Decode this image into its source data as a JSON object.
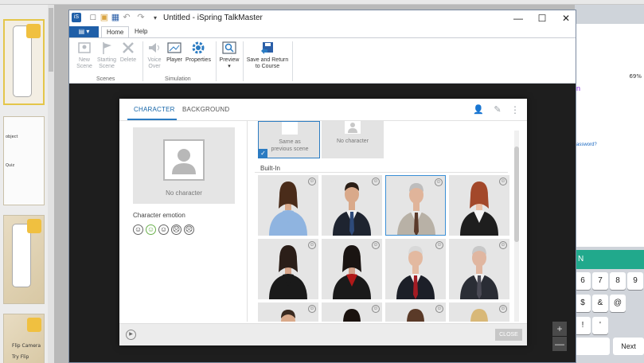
{
  "window": {
    "title": "Untitled - iSpring TalkMaster",
    "app_icon": "ispring-logo-icon",
    "quick_access": [
      "new-icon",
      "open-icon",
      "save-icon",
      "undo-icon",
      "redo-icon",
      "customize-icon"
    ],
    "controls": {
      "minimize": "—",
      "maximize": "☐",
      "close": "✕"
    }
  },
  "ribbon": {
    "file_tab_icon": "file-menu-icon",
    "tabs": [
      {
        "label": "Home",
        "active": true
      },
      {
        "label": "Help",
        "active": false
      }
    ],
    "groups": [
      {
        "label": "Scenes",
        "buttons": [
          {
            "label_line1": "New",
            "label_line2": "Scene",
            "icon": "new-scene-icon",
            "enabled": false
          },
          {
            "label_line1": "Starting",
            "label_line2": "Scene",
            "icon": "flag-icon",
            "enabled": false
          },
          {
            "label_line1": "Delete",
            "label_line2": "",
            "icon": "delete-icon",
            "enabled": false
          }
        ]
      },
      {
        "label": "Simulation",
        "buttons": [
          {
            "label_line1": "Voice",
            "label_line2": "Over",
            "icon": "speaker-icon",
            "enabled": false
          },
          {
            "label_line1": "Player",
            "label_line2": "",
            "icon": "player-icon",
            "enabled": true
          },
          {
            "label_line1": "Properties",
            "label_line2": "",
            "icon": "gear-icon",
            "enabled": true
          }
        ]
      },
      {
        "label": "",
        "buttons": [
          {
            "label_line1": "Preview",
            "label_line2": "▾",
            "icon": "preview-icon",
            "enabled": true
          }
        ]
      },
      {
        "label": "",
        "buttons": [
          {
            "label_line1": "Save and Return",
            "label_line2": "to Course",
            "icon": "save-return-icon",
            "enabled": true
          }
        ]
      }
    ]
  },
  "dialog": {
    "tabs": [
      {
        "label": "CHARACTER",
        "active": true
      },
      {
        "label": "BACKGROUND",
        "active": false
      }
    ],
    "tools": [
      "add-character-icon",
      "edit-icon",
      "more-icon"
    ],
    "preview": {
      "label": "No character"
    },
    "emotion_label": "Character emotion",
    "emotions": [
      {
        "glyph": "☺",
        "name": "neutral-emotion-icon",
        "selected": false
      },
      {
        "glyph": "☺",
        "name": "happy-emotion-icon",
        "selected": true
      },
      {
        "glyph": "☺",
        "name": "smile-emotion-icon",
        "selected": false
      },
      {
        "glyph": "☹",
        "name": "sad-emotion-icon",
        "selected": false
      },
      {
        "glyph": "☹",
        "name": "angry-emotion-icon",
        "selected": false
      }
    ],
    "special_cards": [
      {
        "label_line1": "Same as",
        "label_line2": "previous scene",
        "selected": true
      },
      {
        "label_line1": "No character",
        "label_line2": "",
        "selected": false
      }
    ],
    "builtin_label": "Built-In",
    "characters": [
      {
        "name": "character-woman-blue-shirt",
        "skin": "#d9a98a",
        "hair": "#4a2c1a",
        "outfit": "#8fb4e0",
        "shirt": "#8fb4e0",
        "tie": null,
        "gender": "f",
        "selected": false
      },
      {
        "name": "character-man-dark-suit",
        "skin": "#d9a98a",
        "hair": "#2a1e16",
        "outfit": "#1e2430",
        "shirt": "#f2f2f2",
        "tie": "#2e4a7a",
        "gender": "m",
        "selected": false
      },
      {
        "name": "character-older-man-gray-jacket",
        "skin": "#e0b49a",
        "hair": "#bdbdbd",
        "outfit": "#b8b1a6",
        "shirt": "#eaeaea",
        "tie": "#5a3a2a",
        "gender": "m",
        "selected": true
      },
      {
        "name": "character-redhead-woman",
        "skin": "#ecc0a6",
        "hair": "#a3482a",
        "outfit": "#1e1e1e",
        "shirt": "#f5f5f5",
        "tie": null,
        "gender": "f",
        "selected": false
      },
      {
        "name": "character-woman-black-blazer",
        "skin": "#d7a58a",
        "hair": "#2b1e18",
        "outfit": "#1a1a1a",
        "shirt": "#1a1a1a",
        "tie": null,
        "gender": "f",
        "selected": false
      },
      {
        "name": "character-woman-red-top",
        "skin": "#d3a088",
        "hair": "#1a1412",
        "outfit": "#1a1a1a",
        "shirt": "#b01818",
        "tie": null,
        "gender": "f",
        "selected": false
      },
      {
        "name": "character-older-man-red-tie",
        "skin": "#e3b9a0",
        "hair": "#d8d8d8",
        "outfit": "#1c1f28",
        "shirt": "#f2f2f2",
        "tie": "#a41c24",
        "gender": "m",
        "selected": false
      },
      {
        "name": "character-older-man-glasses",
        "skin": "#e0b6a0",
        "hair": "#c8c8c8",
        "outfit": "#2a2d35",
        "shirt": "#f2f2f2",
        "tie": "#4a4a55",
        "gender": "m",
        "selected": false
      },
      {
        "name": "character-young-man",
        "skin": "#d9a98a",
        "hair": "#3a2a20",
        "outfit": "#24303f",
        "shirt": "#f2f2f2",
        "tie": "#4a5a70",
        "gender": "m",
        "selected": false
      },
      {
        "name": "character-woman-curly-hair",
        "skin": "#7a4a32",
        "hair": "#1a120e",
        "outfit": "#1f1f1f",
        "shirt": "#e8e8e8",
        "tie": null,
        "gender": "f",
        "selected": false
      },
      {
        "name": "character-woman-brown-hair",
        "skin": "#e0b09a",
        "hair": "#5a3a28",
        "outfit": "#202020",
        "shirt": "#f2f2f2",
        "tie": null,
        "gender": "f",
        "selected": false
      },
      {
        "name": "character-blonde-woman",
        "skin": "#ecc4aa",
        "hair": "#d8b878",
        "outfit": "#202020",
        "shirt": "#f2f2f2",
        "tie": null,
        "gender": "f",
        "selected": false
      }
    ],
    "close_label": "CLOSE",
    "play_icon": "play-icon"
  },
  "zoom": {
    "in": "+",
    "out": "—"
  },
  "left_panel": {
    "slide_texts": [
      "object",
      "Quiz",
      "Flip Camera",
      "Try Flip"
    ]
  },
  "right_panel": {
    "status": "69%",
    "link1": "n",
    "link2": "assword?",
    "green_bar": "N",
    "keys": [
      "6",
      "7",
      "8",
      "9",
      "$",
      "&",
      "@",
      "!",
      "'",
      "Next"
    ]
  },
  "colors": {
    "accent": "#2b7bc2",
    "file_tab": "#1f5fa8",
    "stage": "#1e1e1e",
    "phone_green": "#21a98c"
  }
}
